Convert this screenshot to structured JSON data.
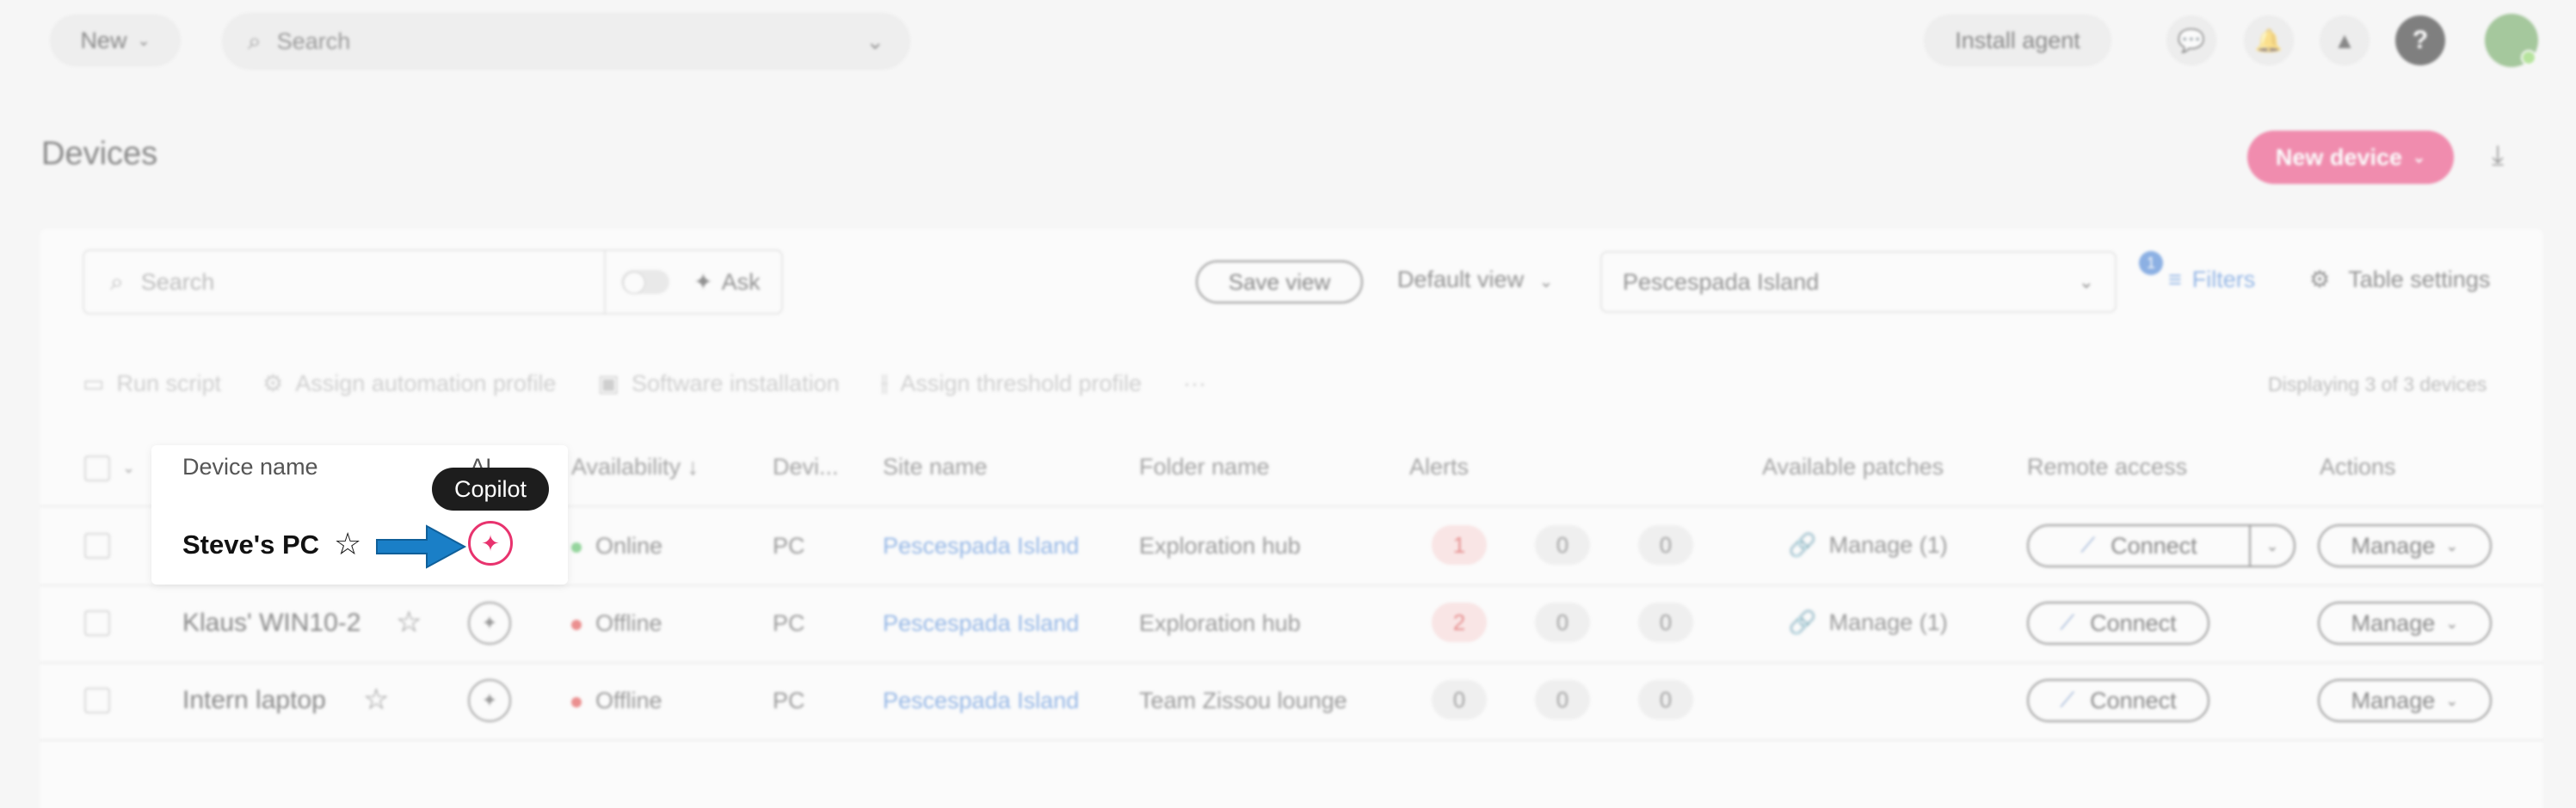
{
  "topbar": {
    "new_label": "New",
    "search_placeholder": "Search",
    "install_label": "Install agent",
    "icons": [
      "chat-icon",
      "bell-icon",
      "warning-icon",
      "help-icon"
    ]
  },
  "page": {
    "title": "Devices",
    "new_device_label": "New device"
  },
  "toolbar": {
    "search_placeholder": "Search",
    "ask_label": "Ask",
    "save_view_label": "Save view",
    "default_view_label": "Default view",
    "site_value": "Pescespada Island",
    "filters_label": "Filters",
    "filters_count": "1",
    "table_settings_label": "Table settings"
  },
  "actions": {
    "run_script": "Run script",
    "assign_automation": "Assign automation profile",
    "software_installation": "Software installation",
    "assign_threshold": "Assign threshold profile",
    "more": "···",
    "displaying": "Displaying 3 of 3 devices"
  },
  "table": {
    "headers": {
      "device_name": "Device name",
      "ai": "AI",
      "availability": "Availability ↓",
      "device": "Devi...",
      "site_name": "Site name",
      "folder_name": "Folder name",
      "alerts": "Alerts",
      "available_patches": "Available patches",
      "remote_access": "Remote access",
      "actions": "Actions"
    },
    "rows": [
      {
        "name": "Steve's PC",
        "status": "Online",
        "status_color": "#3bb54a",
        "device": "PC",
        "site": "Pescespada Island",
        "folder": "Exploration hub",
        "alerts": [
          "1",
          "0",
          "0"
        ],
        "patches": "Manage (1)",
        "connect": "Connect",
        "manage": "Manage"
      },
      {
        "name": "Klaus' WIN10-2",
        "status": "Offline",
        "status_color": "#e03030",
        "device": "PC",
        "site": "Pescespada Island",
        "folder": "Exploration hub",
        "alerts": [
          "2",
          "0",
          "0"
        ],
        "patches": "Manage (1)",
        "connect": "Connect",
        "manage": "Manage"
      },
      {
        "name": "Intern laptop",
        "status": "Offline",
        "status_color": "#e03030",
        "device": "PC",
        "site": "Pescespada Island",
        "folder": "Team Zissou lounge",
        "alerts": [
          "0",
          "0",
          "0"
        ],
        "patches": "",
        "connect": "Connect",
        "manage": "Manage"
      }
    ]
  },
  "tooltip": {
    "label": "Copilot"
  },
  "colors": {
    "accent": "#ea2a6b",
    "copilot": "#e8336e",
    "arrow": "#1a7fc7",
    "link": "#3a7bd5"
  }
}
